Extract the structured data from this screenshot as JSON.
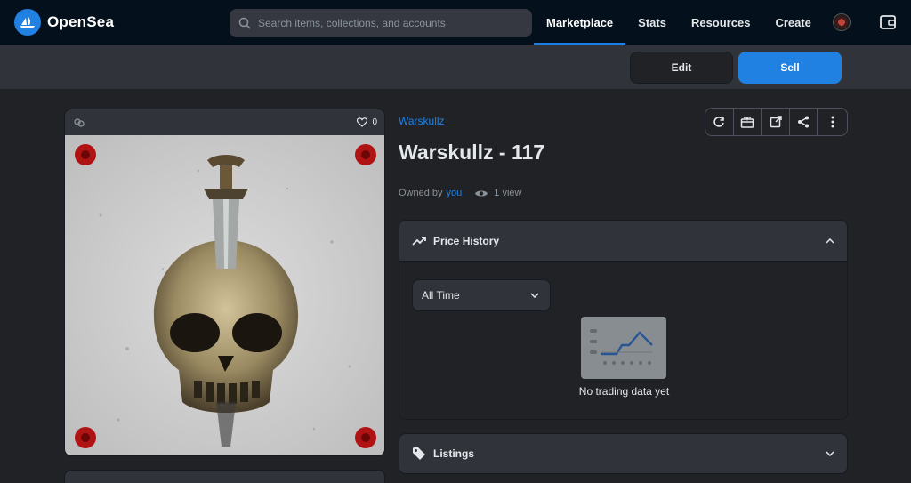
{
  "brand": {
    "name": "OpenSea",
    "accent": "#2081e2",
    "nav_bg": "#04111d"
  },
  "search": {
    "placeholder": "Search items, collections, and accounts"
  },
  "nav": [
    {
      "label": "Marketplace",
      "active": true
    },
    {
      "label": "Stats"
    },
    {
      "label": "Resources"
    },
    {
      "label": "Create"
    }
  ],
  "actions": {
    "edit_label": "Edit",
    "sell_label": "Sell"
  },
  "asset": {
    "favorites": "0",
    "collection": "Warskullz",
    "title": "Warskullz - 117",
    "owned_by_prefix": "Owned by",
    "owner": "you",
    "views": "1 view"
  },
  "toolbar": [
    "refresh-icon",
    "transfer-icon",
    "open-external-icon",
    "share-icon",
    "more-icon"
  ],
  "price_history": {
    "title": "Price History",
    "range_selected": "All Time",
    "empty_text": "No trading data yet"
  },
  "listings": {
    "title": "Listings"
  }
}
